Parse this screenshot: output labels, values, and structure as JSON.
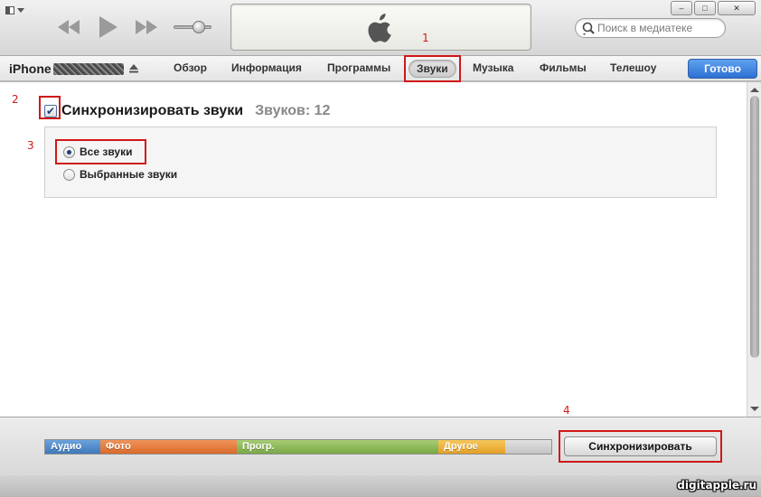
{
  "window": {
    "minimize_glyph": "–",
    "maximize_glyph": "□",
    "close_glyph": "✕"
  },
  "search": {
    "placeholder": "Поиск в медиатеке"
  },
  "device": {
    "name": "iPhone"
  },
  "tabs": [
    {
      "label": "Обзор"
    },
    {
      "label": "Информация"
    },
    {
      "label": "Программы"
    },
    {
      "label": "Звуки",
      "active": true
    },
    {
      "label": "Музыка"
    },
    {
      "label": "Фильмы"
    },
    {
      "label": "Телешоу"
    }
  ],
  "done_label": "Готово",
  "sync_section": {
    "checked": true,
    "title": "Синхронизировать звуки",
    "count_text": "Звуков: 12",
    "options": [
      {
        "label": "Все звуки",
        "selected": true
      },
      {
        "label": "Выбранные звуки",
        "selected": false
      }
    ]
  },
  "capacity_bar": {
    "segments": [
      {
        "label": "Аудио",
        "color": "#4f89c8"
      },
      {
        "label": "Фото",
        "color": "#e57b3a"
      },
      {
        "label": "Прогр.",
        "color": "#8ab858"
      },
      {
        "label": "Другое",
        "color": "#f0b23d"
      },
      {
        "label": "",
        "color": "#d0d0d0"
      }
    ]
  },
  "sync_button_label": "Синхронизировать",
  "watermark": "digitapple.ru",
  "annotations": {
    "tab": "1",
    "checkbox": "2",
    "radio": "3",
    "sync_button": "4"
  },
  "colors": {
    "annotation": "#d01818",
    "done_button": "#2e70d3"
  },
  "icons": [
    "system-menu-icon",
    "previous-icon",
    "play-icon",
    "next-icon",
    "apple-logo-icon",
    "search-icon",
    "eject-icon"
  ]
}
